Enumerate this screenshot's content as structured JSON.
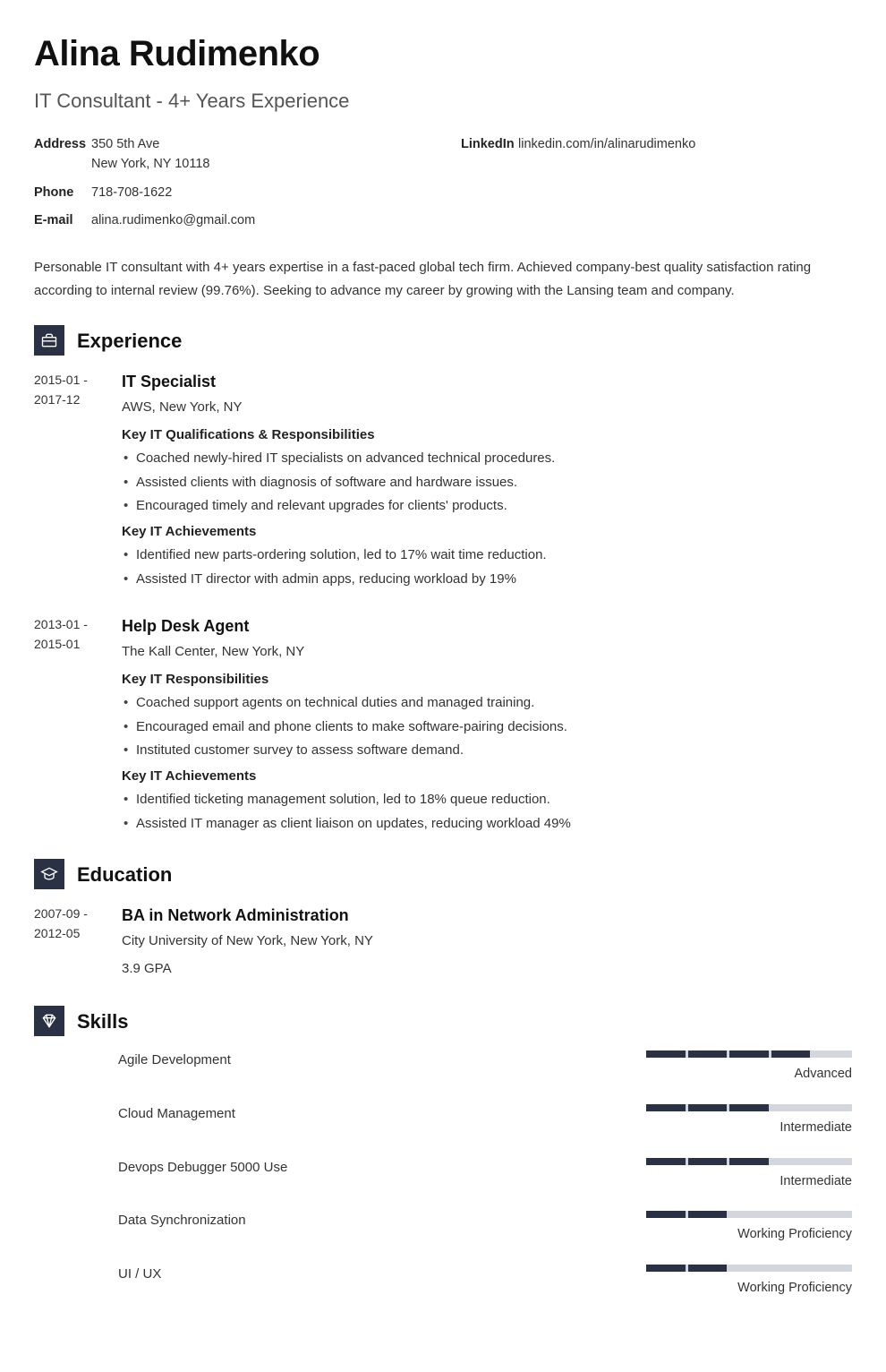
{
  "name": "Alina Rudimenko",
  "headline": "IT Consultant - 4+ Years Experience",
  "contact_left": [
    {
      "label": "Address",
      "value": "350 5th Ave\nNew York, NY 10118"
    },
    {
      "label": "Phone",
      "value": "718-708-1622"
    },
    {
      "label": "E-mail",
      "value": "alina.rudimenko@gmail.com"
    }
  ],
  "contact_right": [
    {
      "label": "LinkedIn",
      "value": "linkedin.com/in/alinarudimenko"
    }
  ],
  "summary": "Personable IT consultant with 4+ years expertise in a fast-paced global tech firm. Achieved company-best quality satisfaction rating according to internal review (99.76%). Seeking to advance my career by growing with the Lansing team and company.",
  "sections": {
    "experience": {
      "title": "Experience",
      "entries": [
        {
          "date_start": "2015-01 -",
          "date_end": "2017-12",
          "title": "IT Specialist",
          "subtitle": "AWS, New York, NY",
          "blocks": [
            {
              "heading": "Key IT Qualifications & Responsibilities",
              "items": [
                "Coached newly-hired IT specialists on advanced technical procedures.",
                "Assisted clients with diagnosis of software and hardware issues.",
                "Encouraged timely and relevant upgrades for clients' products."
              ]
            },
            {
              "heading": "Key IT Achievements",
              "items": [
                "Identified new parts-ordering solution, led to 17% wait time reduction.",
                "Assisted IT director with admin apps, reducing workload by 19%"
              ]
            }
          ]
        },
        {
          "date_start": "2013-01 -",
          "date_end": "2015-01",
          "title": "Help Desk Agent",
          "subtitle": "The Kall Center, New York, NY",
          "blocks": [
            {
              "heading": "Key IT Responsibilities",
              "items": [
                "Coached support agents on technical duties and managed training.",
                "Encouraged email and phone clients to make software-pairing decisions.",
                "Instituted customer survey to assess software demand."
              ]
            },
            {
              "heading": "Key IT Achievements",
              "items": [
                "Identified ticketing management solution, led to 18% queue reduction.",
                "Assisted IT manager as client liaison on updates, reducing workload 49%"
              ]
            }
          ]
        }
      ]
    },
    "education": {
      "title": "Education",
      "entries": [
        {
          "date_start": "2007-09 -",
          "date_end": "2012-05",
          "title": "BA in Network Administration",
          "subtitle": "City University of New York, New York, NY",
          "extra": "3.9 GPA"
        }
      ]
    },
    "skills": {
      "title": "Skills",
      "items": [
        {
          "name": "Agile Development",
          "level": "Advanced",
          "filled": 4,
          "total": 5
        },
        {
          "name": "Cloud Management",
          "level": "Intermediate",
          "filled": 3,
          "total": 5
        },
        {
          "name": "Devops Debugger 5000 Use",
          "level": "Intermediate",
          "filled": 3,
          "total": 5
        },
        {
          "name": "Data Synchronization",
          "level": "Working Proficiency",
          "filled": 2,
          "total": 5
        },
        {
          "name": "UI / UX",
          "level": "Working Proficiency",
          "filled": 2,
          "total": 5
        }
      ]
    }
  }
}
